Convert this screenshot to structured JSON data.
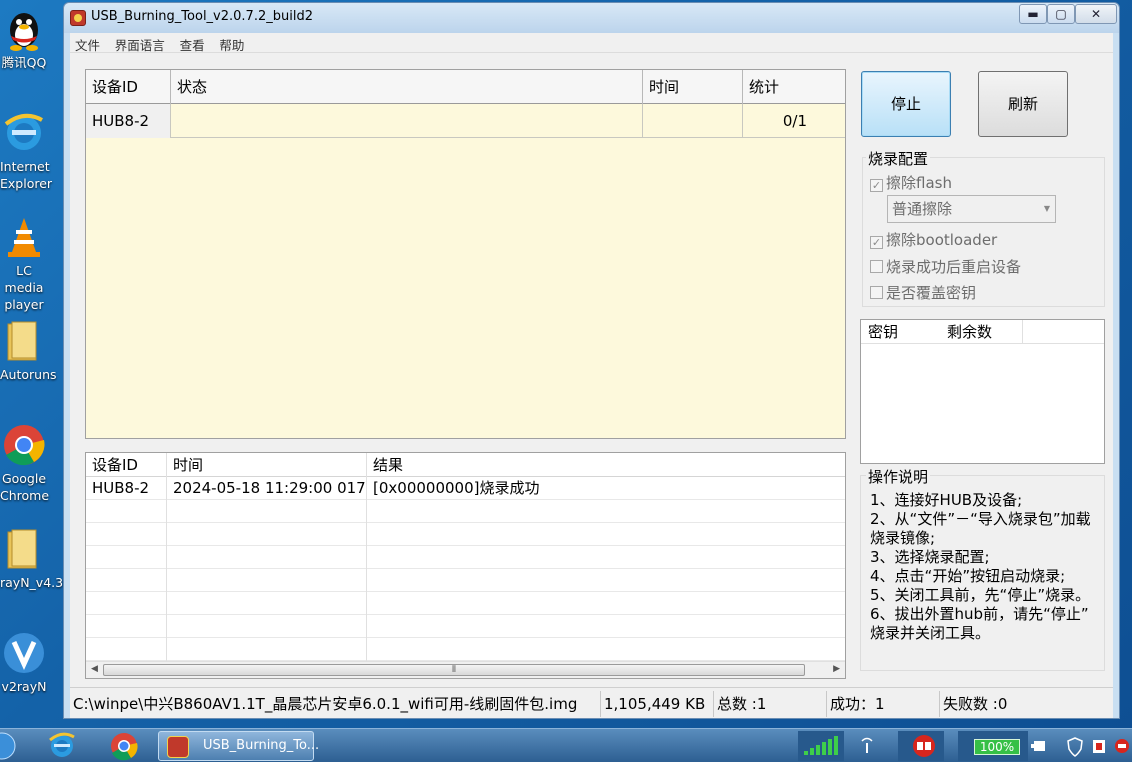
{
  "desktop": {
    "icons": [
      {
        "label1": "腾讯QQ",
        "label2": ""
      },
      {
        "label1": "Internet",
        "label2": "Explorer"
      },
      {
        "label1": "LC media",
        "label2": "player"
      },
      {
        "label1": "Autoruns",
        "label2": ""
      },
      {
        "label1": "Google",
        "label2": "Chrome"
      },
      {
        "label1": "rayN_v4.3",
        "label2": ""
      },
      {
        "label1": "v2rayN",
        "label2": ""
      }
    ]
  },
  "window": {
    "title": "USB_Burning_Tool_v2.0.7.2_build2",
    "minimize": "▬",
    "maximize": "▢",
    "close": "✕"
  },
  "menubar": [
    "文件",
    "界面语言",
    "查看",
    "帮助"
  ],
  "device_table": {
    "headers": [
      "设备ID",
      "状态",
      "时间",
      "统计"
    ],
    "rows": [
      {
        "device_id": "HUB8-2",
        "status": "",
        "time": "",
        "stats": "0/1"
      }
    ]
  },
  "log_table": {
    "headers": [
      "设备ID",
      "时间",
      "结果"
    ],
    "rows": [
      {
        "device_id": "HUB8-2",
        "time": "2024-05-18 11:29:00 017",
        "result": "[0x00000000]烧录成功"
      }
    ],
    "scroll_grip": "⦀"
  },
  "buttons": {
    "stop": "停止",
    "refresh": "刷新"
  },
  "burn_config": {
    "title": "烧录配置",
    "erase_flash": {
      "label": "擦除flash",
      "checked": true
    },
    "erase_mode": "普通擦除",
    "erase_bootloader": {
      "label": "擦除bootloader",
      "checked": true
    },
    "reboot_after": {
      "label": "烧录成功后重启设备",
      "checked": false
    },
    "overwrite_key": {
      "label": "是否覆盖密钥",
      "checked": false
    }
  },
  "key_table": {
    "headers": [
      "密钥",
      "剩余数"
    ]
  },
  "instructions": {
    "title": "操作说明",
    "lines": [
      "1、连接好HUB及设备;",
      "2、从“文件”－“导入烧录包”加载",
      "烧录镜像;",
      "3、选择烧录配置;",
      "4、点击“开始”按钮启动烧录;",
      "5、关闭工具前，先“停止”烧录。",
      "6、拔出外置hub前，请先“停止”",
      "烧录并关闭工具。"
    ]
  },
  "statusbar": {
    "image_path": "C:\\winpe\\中兴B860AV1.1T_晶晨芯片安卓6.0.1_wifi可用-线刷固件包.img",
    "size": "1,105,449 KB",
    "total": "总数 :1",
    "success": "成功：1",
    "fail": "失败数 :0"
  },
  "taskbar": {
    "active_app": "USB_Burning_To...",
    "battery": "100%"
  },
  "colors": {
    "grid_bg": "#fdf9dc",
    "stop_btn": "#b8e0f7",
    "taskbar": "#2d5f92"
  }
}
